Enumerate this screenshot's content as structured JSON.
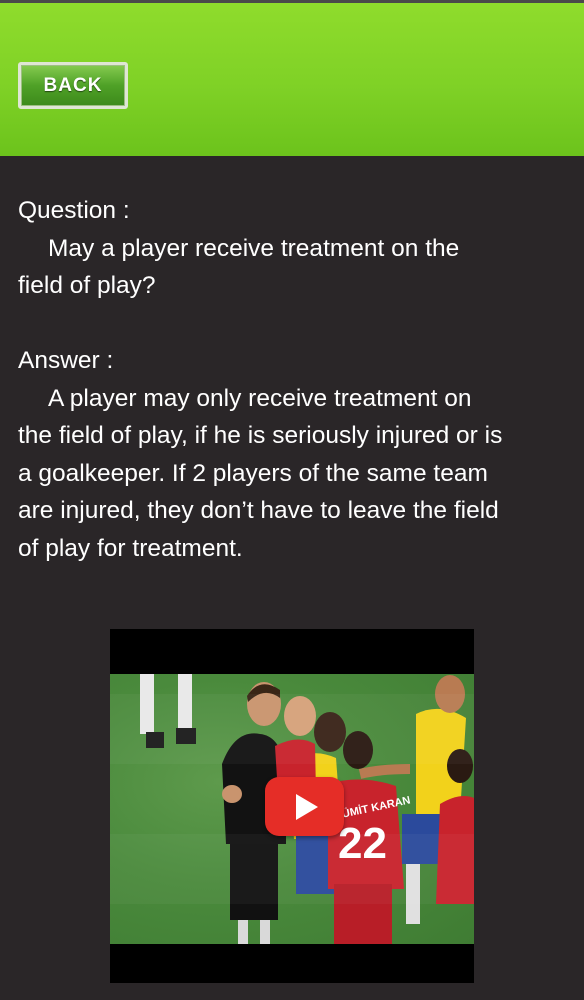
{
  "header": {
    "back_label": "BACK"
  },
  "qa": {
    "question_label": "Question :",
    "question_line1": "May a player receive treatment on the",
    "question_line2": "field of play?",
    "answer_label": "Answer :",
    "answer_line1": "A player may only receive treatment on",
    "answer_line2": "the field of play, if he is seriously injured or is",
    "answer_line3": "a goalkeeper. If 2 players of the same team",
    "answer_line4": "are injured, they don’t have to leave the field",
    "answer_line5": "of play for treatment."
  },
  "video": {
    "jersey_number": "22",
    "jersey_name": "ÜMİT KARAN",
    "play_icon": "play-icon",
    "colors": {
      "play_button": "#e52d27",
      "pitch": "#4a8a3c",
      "referee_kit": "#111111",
      "red_kit": "#c8232c",
      "yellow_kit": "#f2d21b"
    }
  }
}
